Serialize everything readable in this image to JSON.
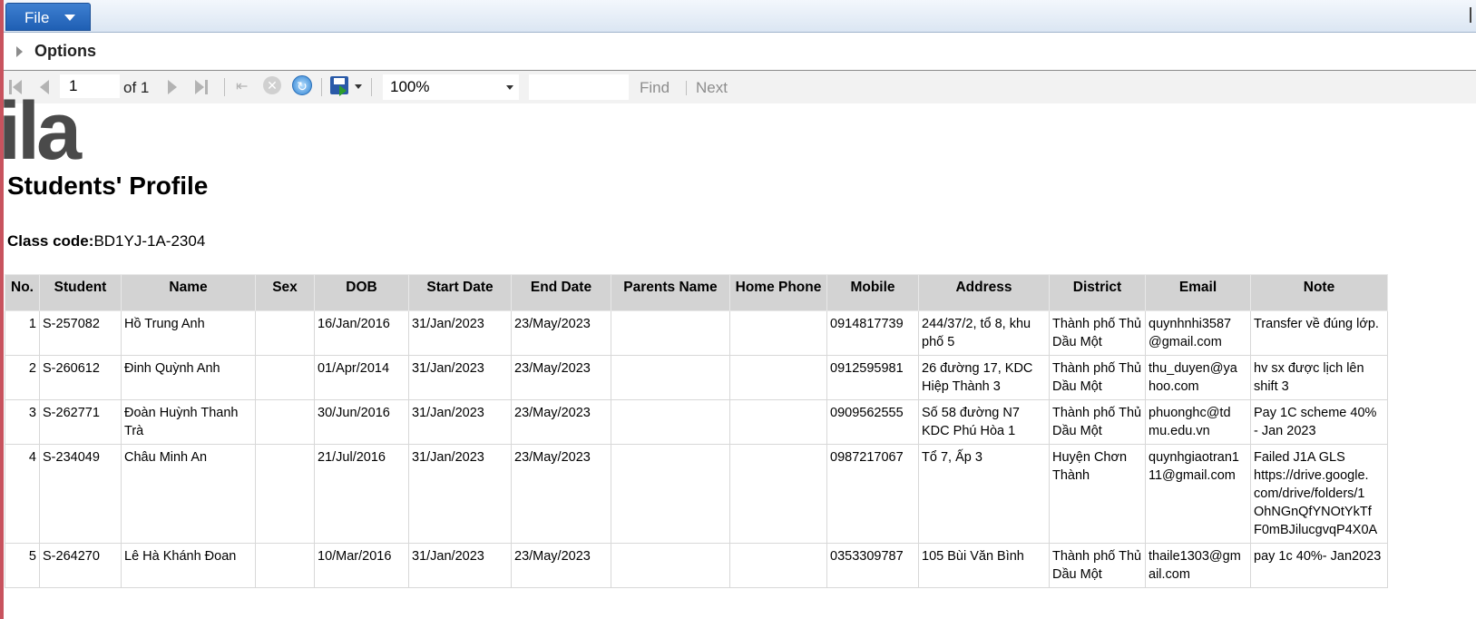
{
  "menu": {
    "file_label": "File"
  },
  "options": {
    "label": "Options"
  },
  "toolbar": {
    "page_value": "1",
    "of_label": "of 1",
    "zoom_value": "100%",
    "find_label": "Find",
    "next_label": "Next"
  },
  "report": {
    "logo_text": "ila",
    "title": "Students' Profile",
    "class_code_label": "Class code:",
    "class_code_value": "BD1YJ-1A-2304"
  },
  "table": {
    "headers": [
      "No.",
      "Student",
      "Name",
      "Sex",
      "DOB",
      "Start Date",
      "End Date",
      "Parents Name",
      "Home Phone",
      "Mobile",
      "Address",
      "District",
      "Email",
      "Note"
    ],
    "rows": [
      [
        "1",
        "S-257082",
        "Hồ Trung Anh",
        "",
        "16/Jan/2016",
        "31/Jan/2023",
        "23/May/2023",
        "",
        "",
        "0914817739",
        "244/37/2, tổ 8, khu phố 5",
        "Thành phố Thủ Dầu Một",
        "quynhnhi3587 @gmail.com",
        "Transfer về đúng lớp."
      ],
      [
        "2",
        "S-260612",
        "Đinh Quỳnh Anh",
        "",
        "01/Apr/2014",
        "31/Jan/2023",
        "23/May/2023",
        "",
        "",
        "0912595981",
        "26 đường 17, KDC Hiệp Thành 3",
        "Thành phố Thủ Dầu Một",
        "thu_duyen@ya hoo.com",
        "hv sx được lịch lên shift 3"
      ],
      [
        "3",
        "S-262771",
        "Đoàn Huỳnh Thanh Trà",
        "",
        "30/Jun/2016",
        "31/Jan/2023",
        "23/May/2023",
        "",
        "",
        "0909562555",
        "Số 58 đường N7 KDC Phú Hòa 1",
        "Thành phố Thủ Dầu Một",
        "phuonghc@td mu.edu.vn",
        "Pay 1C scheme 40% - Jan 2023"
      ],
      [
        "4",
        "S-234049",
        "Châu Minh An",
        "",
        "21/Jul/2016",
        "31/Jan/2023",
        "23/May/2023",
        "",
        "",
        "0987217067",
        "Tổ 7, Ấp 3",
        "Huyện Chơn Thành",
        "quynhgiaotran1 11@gmail.com",
        "Failed J1A GLS https://drive.google. com/drive/folders/1 OhNGnQfYNOtYkTf F0mBJilucgvqP4X0A"
      ],
      [
        "5",
        "S-264270",
        "Lê Hà Khánh Đoan",
        "",
        "10/Mar/2016",
        "31/Jan/2023",
        "23/May/2023",
        "",
        "",
        "0353309787",
        "105 Bùi Văn Bình",
        "Thành phố Thủ Dầu Một",
        "thaile1303@gm ail.com",
        "pay 1c 40%- Jan2023"
      ]
    ]
  }
}
